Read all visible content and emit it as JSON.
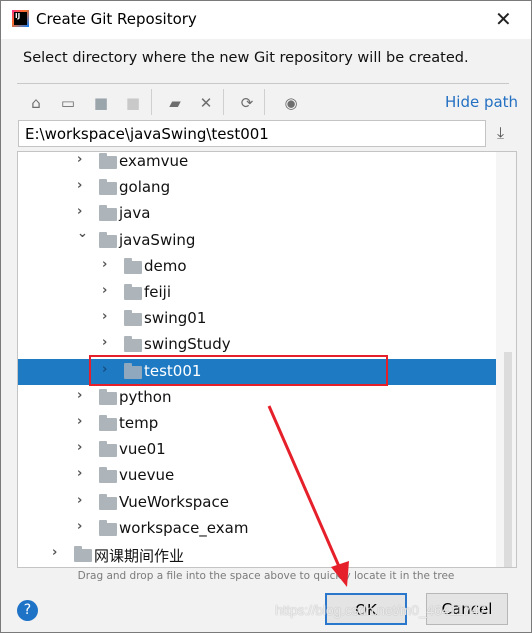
{
  "window": {
    "title": "Create Git Repository",
    "logo_text": "IJ"
  },
  "description": "Select directory where the new Git repository will be created.",
  "toolbar": {
    "hide_path_label": "Hide path",
    "icons": [
      "home-icon",
      "desktop-icon",
      "project-folder-icon",
      "module-folder-icon",
      "new-folder-icon",
      "delete-icon",
      "refresh-icon",
      "show-hidden-icon"
    ]
  },
  "path_value": "E:\\workspace\\javaSwing\\test001",
  "tree": [
    {
      "label": "examvue",
      "level": 1
    },
    {
      "label": "golang",
      "level": 1
    },
    {
      "label": "java",
      "level": 1
    },
    {
      "label": "javaSwing",
      "level": 1,
      "expanded": true
    },
    {
      "label": "demo",
      "level": 2
    },
    {
      "label": "feiji",
      "level": 2
    },
    {
      "label": "swing01",
      "level": 2
    },
    {
      "label": "swingStudy",
      "level": 2
    },
    {
      "label": "test001",
      "level": 2,
      "selected": true
    },
    {
      "label": "python",
      "level": 1
    },
    {
      "label": "temp",
      "level": 1
    },
    {
      "label": "vue01",
      "level": 1
    },
    {
      "label": "vuevue",
      "level": 1
    },
    {
      "label": "VueWorkspace",
      "level": 1
    },
    {
      "label": "workspace_exam",
      "level": 1
    },
    {
      "label": "网课期间作业",
      "level": 0
    }
  ],
  "hint": "Drag and drop a file into the space above to quickly locate it in the tree",
  "buttons": {
    "ok": "OK",
    "cancel": "Cancel",
    "help": "?"
  },
  "watermark": "https://blog.csdn.net/m0_46411747",
  "colors": {
    "selection": "#1f7ac4",
    "link": "#2470c2",
    "annotation": "#e6202a"
  }
}
